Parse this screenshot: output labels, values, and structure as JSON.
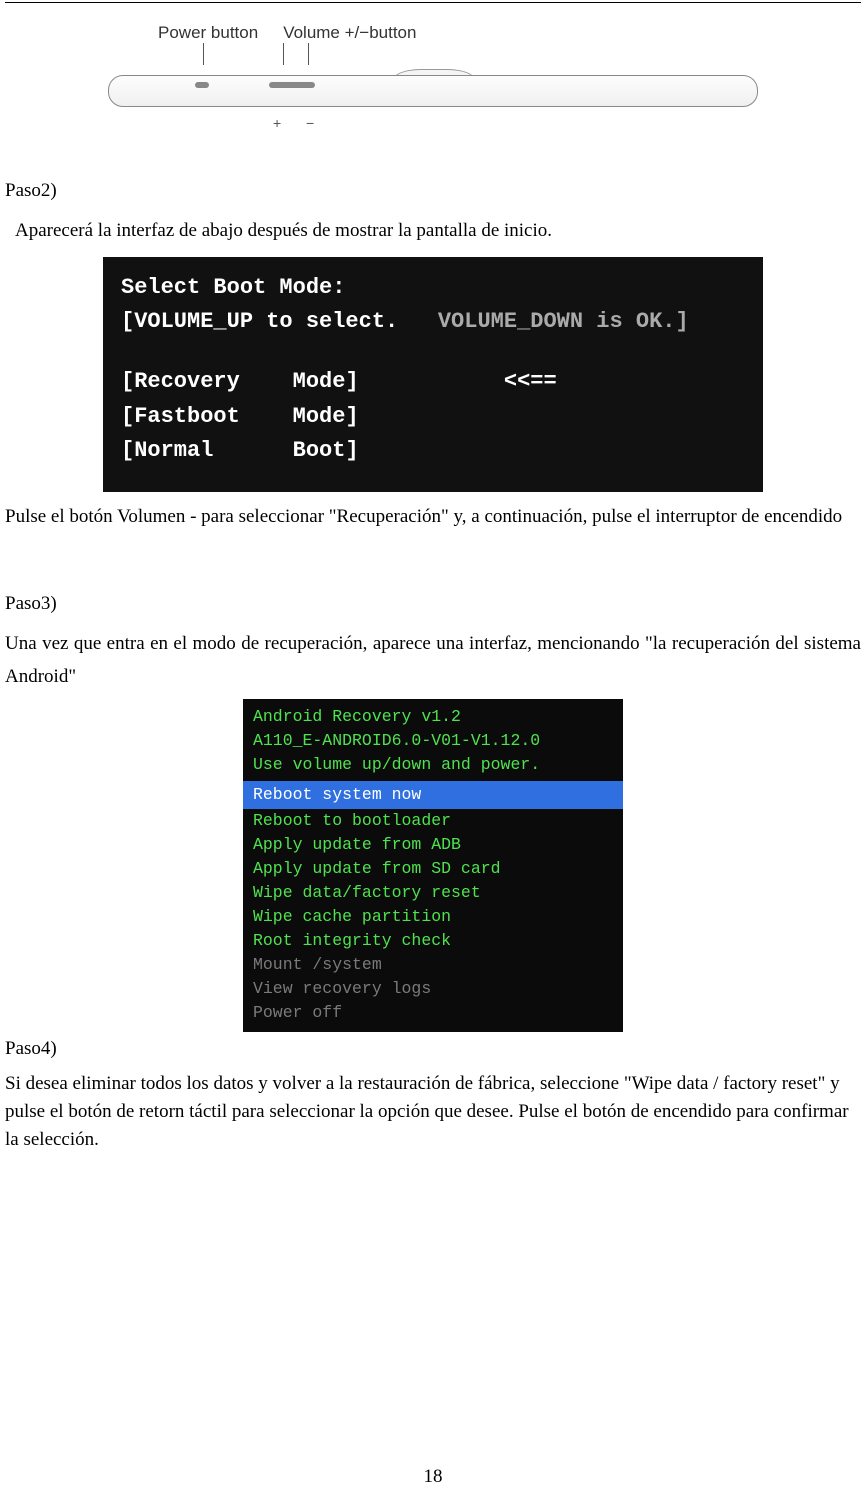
{
  "figure1": {
    "label_power": "Power button",
    "label_volume": "Volume +/−button",
    "plus": "+",
    "minus": "−"
  },
  "step2": {
    "label": "Paso2)",
    "intro": "Aparecerá la interfaz de abajo después de mostrar la pantalla de inicio.",
    "screen": {
      "title": "Select Boot Mode:",
      "hint_a": "[VOLUME_UP to select.",
      "hint_b": "VOLUME_DOWN is OK.]",
      "row1a": "[Recovery",
      "row1b": "Mode]",
      "row1c": "<<==",
      "row2a": "[Fastboot",
      "row2b": "Mode]",
      "row3a": "[Normal",
      "row3b": "Boot]"
    },
    "after": "Pulse el botón Volumen - para seleccionar \"Recuperación\" y, a continuación, pulse el interruptor de encendido"
  },
  "step3": {
    "label": "Paso3)",
    "intro": "Una vez que entra en el modo de recuperación, aparece una interfaz, mencionando \"la recuperación del sistema Android\"",
    "screen": {
      "hdr1": "Android Recovery v1.2",
      "hdr2": "A110_E-ANDROID6.0-V01-V1.12.0",
      "hdr3": "Use volume up/down and power.",
      "highlight": "Reboot system now",
      "opts": [
        "Reboot to bootloader",
        "Apply update from ADB",
        "Apply update from SD card",
        "Wipe data/factory reset",
        "Wipe cache partition",
        "Root integrity check",
        "Mount /system",
        "View recovery logs",
        "Power off"
      ]
    }
  },
  "step4": {
    "label": "Paso4)",
    "text": "Si desea eliminar todos los datos y volver a la restauración de fábrica, seleccione \"Wipe data / factory reset\" y pulse el botón de retorn táctil para seleccionar la opción que desee. Pulse el botón de encendido para confirmar la selección."
  },
  "page_number": "18"
}
